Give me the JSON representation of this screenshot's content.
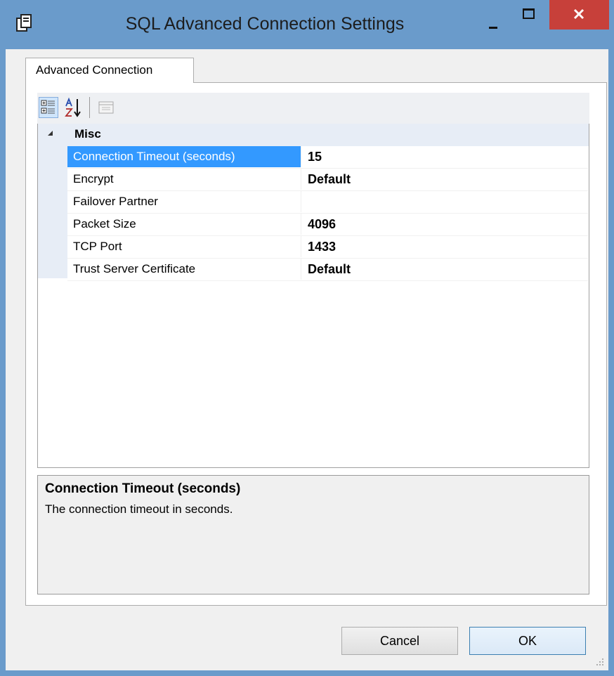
{
  "window": {
    "title": "SQL Advanced Connection Settings",
    "controls": {
      "minimize": "minimize",
      "maximize": "maximize",
      "close": "close"
    },
    "colors": {
      "frame": "#6a9bcb",
      "close_button": "#c7403a",
      "selection": "#3399ff"
    }
  },
  "tabs": [
    {
      "label": "Advanced Connection",
      "selected": true
    }
  ],
  "toolbar": {
    "buttons": [
      {
        "icon": "categorized-icon",
        "active": true
      },
      {
        "icon": "alphabetical-sort-icon",
        "active": false
      },
      {
        "icon": "property-pages-icon",
        "active": false,
        "disabled": true
      }
    ]
  },
  "property_grid": {
    "category": "Misc",
    "properties": [
      {
        "name": "Connection Timeout (seconds)",
        "value": "15",
        "selected": true
      },
      {
        "name": "Encrypt",
        "value": "Default"
      },
      {
        "name": "Failover Partner",
        "value": ""
      },
      {
        "name": "Packet Size",
        "value": "4096"
      },
      {
        "name": "TCP Port",
        "value": "1433"
      },
      {
        "name": "Trust Server Certificate",
        "value": "Default"
      }
    ]
  },
  "help": {
    "title": "Connection Timeout (seconds)",
    "description": "The connection timeout in seconds."
  },
  "buttons": {
    "cancel": "Cancel",
    "ok": "OK"
  }
}
